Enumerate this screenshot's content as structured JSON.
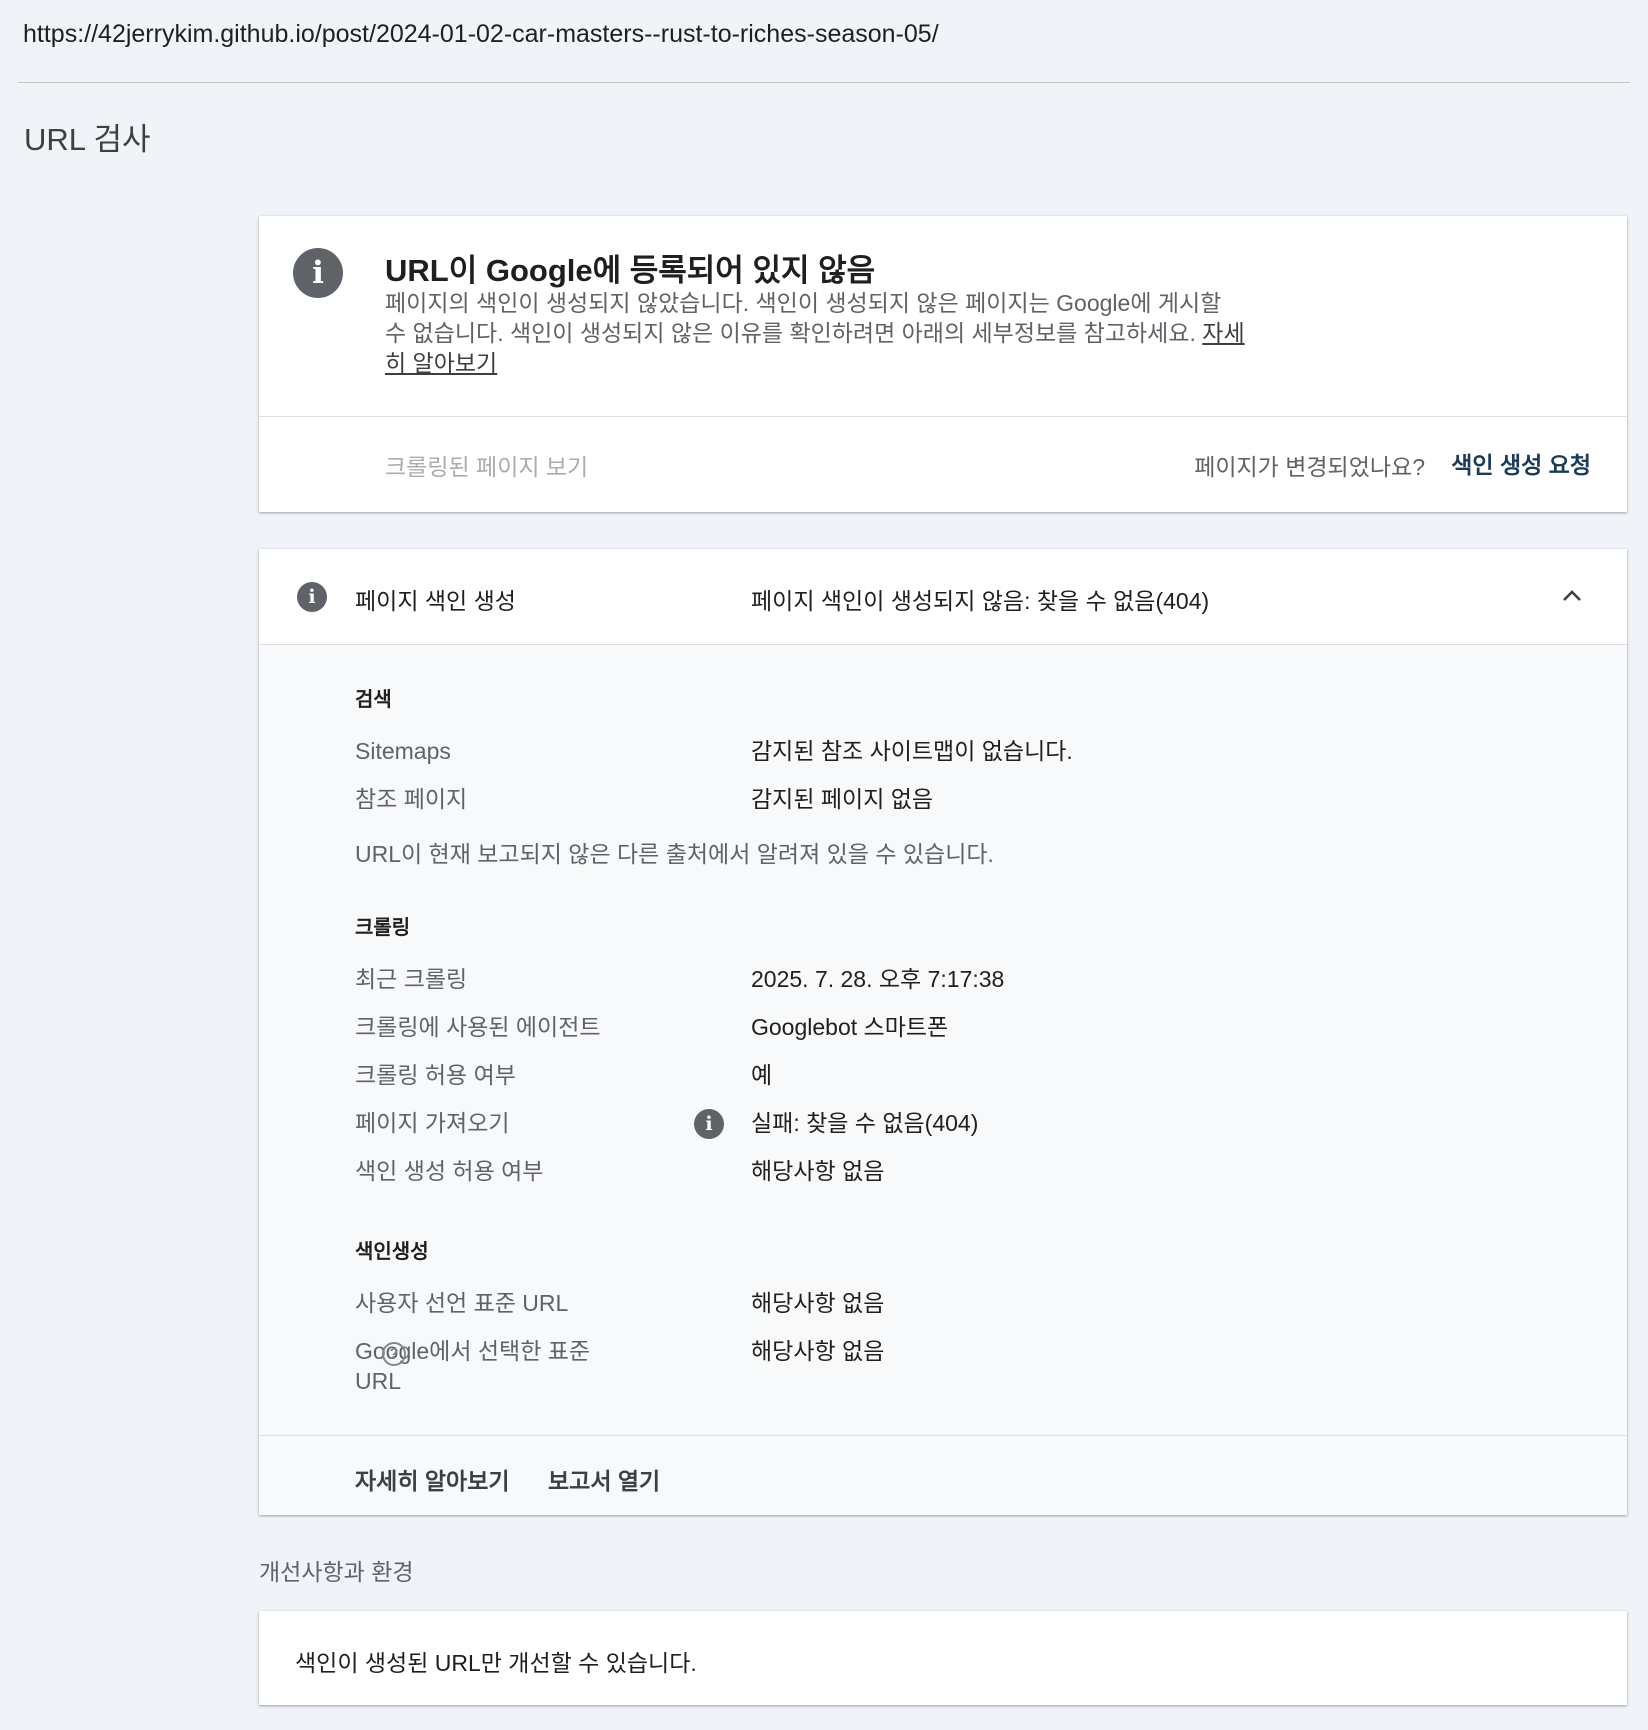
{
  "url": "https://42jerrykim.github.io/post/2024-01-02-car-masters--rust-to-riches-season-05/",
  "page_title": "URL 검사",
  "status_card": {
    "icon": "info-icon",
    "title": "URL이 Google에 등록되어 있지 않음",
    "description": "페이지의 색인이 생성되지 않았습니다. 색인이 생성되지 않은 페이지는 Google에 게시할 수 없습니다. 색인이 생성되지 않은 이유를 확인하려면 아래의 세부정보를 참고하세요.",
    "learn_more": "자세히 알아보기",
    "view_crawled": "크롤링된 페이지 보기",
    "changed_question": "페이지가 변경되었나요?",
    "request_indexing": "색인 생성 요청"
  },
  "indexing_card": {
    "label": "페이지 색인 생성",
    "value": "페이지 색인이 생성되지 않음: 찾을 수 없음(404)",
    "discovery": {
      "title": "검색",
      "sitemaps_label": "Sitemaps",
      "sitemaps_value": "감지된 참조 사이트맵이 없습니다.",
      "referring_label": "참조 페이지",
      "referring_value": "감지된 페이지 없음",
      "note": "URL이 현재 보고되지 않은 다른 출처에서 알려져 있을 수 있습니다."
    },
    "crawl": {
      "title": "크롤링",
      "last_crawl_label": "최근 크롤링",
      "last_crawl_value": "2025. 7. 28. 오후 7:17:38",
      "agent_label": "크롤링에 사용된 에이전트",
      "agent_value": "Googlebot 스마트폰",
      "allowed_label": "크롤링 허용 여부",
      "allowed_value": "예",
      "fetch_label": "페이지 가져오기",
      "fetch_value": "실패: 찾을 수 없음(404)",
      "index_allowed_label": "색인 생성 허용 여부",
      "index_allowed_value": "해당사항 없음"
    },
    "indexing": {
      "title": "색인생성",
      "user_canonical_label": "사용자 선언 표준 URL",
      "user_canonical_value": "해당사항 없음",
      "google_canonical_label": "Google에서 선택한 표준 URL",
      "google_canonical_value": "해당사항 없음"
    },
    "footer": {
      "learn_more": "자세히 알아보기",
      "open_report": "보고서 열기"
    }
  },
  "enhancements": {
    "heading": "개선사항과 환경",
    "message": "색인이 생성된 URL만 개선할 수 있습니다."
  },
  "colors": {
    "background": "#f0f4f9",
    "card": "#ffffff",
    "icon_gray": "#5f6368",
    "accent_dark": "#1a3c5a"
  }
}
